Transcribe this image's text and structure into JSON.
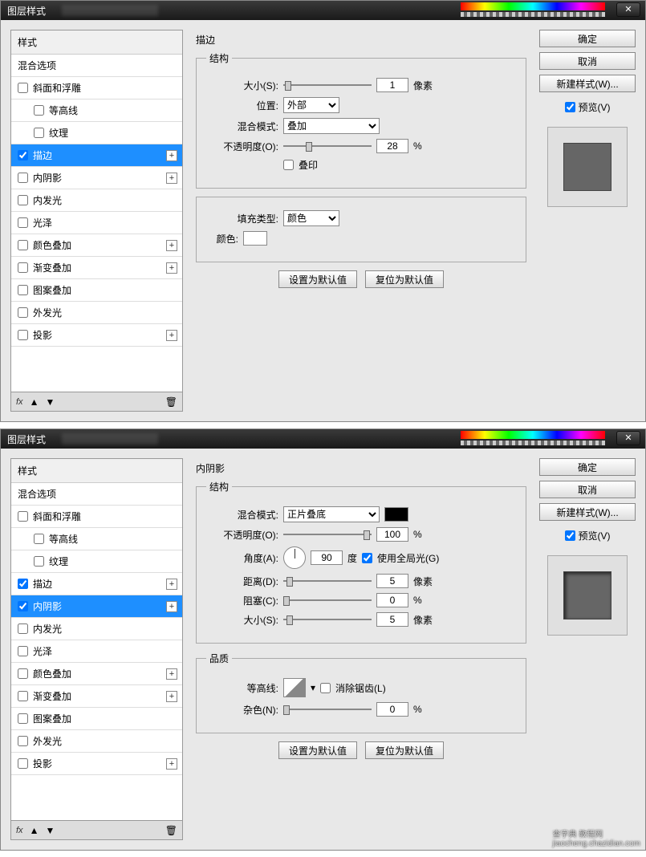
{
  "common": {
    "window_title": "图层样式",
    "styles_header": "样式",
    "blend_options": "混合选项",
    "items": {
      "bevel": "斜面和浮雕",
      "contour": "等高线",
      "texture": "纹理",
      "stroke": "描边",
      "inner_shadow": "内阴影",
      "inner_glow": "内发光",
      "satin": "光泽",
      "color_overlay": "颜色叠加",
      "gradient_overlay": "渐变叠加",
      "pattern_overlay": "图案叠加",
      "outer_glow": "外发光",
      "drop_shadow": "投影"
    },
    "buttons": {
      "ok": "确定",
      "cancel": "取消",
      "new_style": "新建样式(W)...",
      "preview": "预览(V)",
      "make_default": "设置为默认值",
      "reset_default": "复位为默认值"
    },
    "fx_label": "fx"
  },
  "win1": {
    "selected": "stroke",
    "title": "描边",
    "structure": "结构",
    "size_label": "大小(S):",
    "size_value": "1",
    "size_unit": "像素",
    "position_label": "位置:",
    "position_value": "外部",
    "blend_mode_label": "混合模式:",
    "blend_mode_value": "叠加",
    "opacity_label": "不透明度(O):",
    "opacity_value": "28",
    "opacity_unit": "%",
    "overprint": "叠印",
    "fill_type_label": "填充类型:",
    "fill_type_value": "颜色",
    "color_label": "颜色:"
  },
  "win2": {
    "selected": "inner_shadow",
    "title": "内阴影",
    "structure": "结构",
    "blend_mode_label": "混合模式:",
    "blend_mode_value": "正片叠底",
    "opacity_label": "不透明度(O):",
    "opacity_value": "100",
    "opacity_unit": "%",
    "angle_label": "角度(A):",
    "angle_value": "90",
    "angle_unit": "度",
    "use_global": "使用全局光(G)",
    "distance_label": "距离(D):",
    "distance_value": "5",
    "distance_unit": "像素",
    "choke_label": "阻塞(C):",
    "choke_value": "0",
    "choke_unit": "%",
    "size_label": "大小(S):",
    "size_value": "5",
    "size_unit": "像素",
    "quality": "品质",
    "contour_label": "等高线:",
    "antialias": "消除锯齿(L)",
    "noise_label": "杂色(N):",
    "noise_value": "0",
    "noise_unit": "%"
  },
  "watermark": "查字典 教程网",
  "watermark_url": "jiaocheng.chazidian.com"
}
